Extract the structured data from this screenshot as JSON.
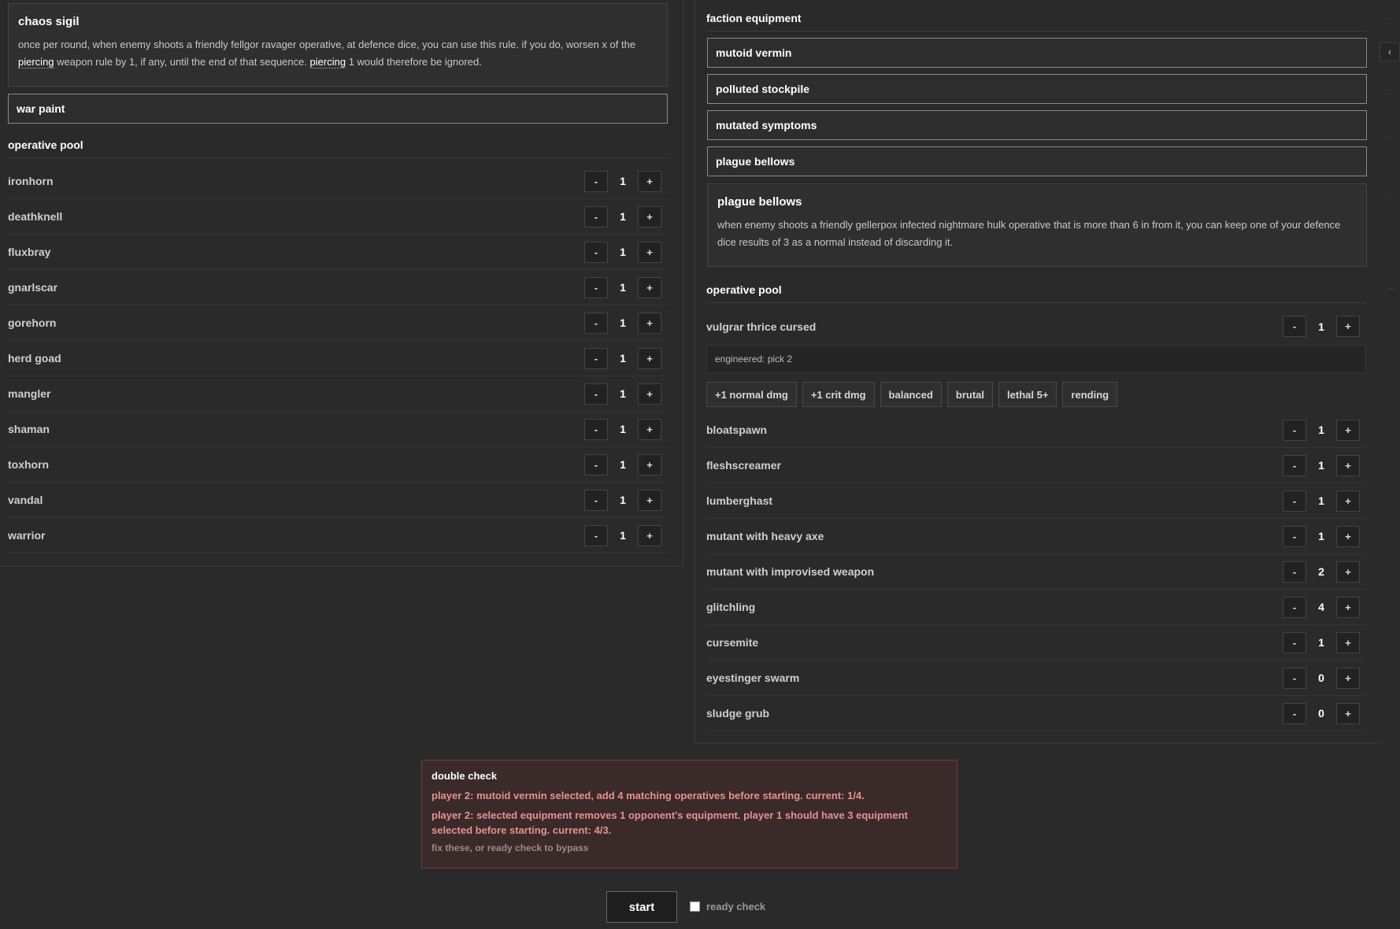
{
  "left": {
    "chaos_sigil": {
      "title": "chaos sigil",
      "text_1": "once per round, when enemy shoots a friendly fellgor ravager operative, at defence dice, you can use this rule. if you do, worsen x of the",
      "kw_1": "piercing",
      "text_2": "weapon rule by 1, if any, until the end of that sequence.",
      "kw_2": "piercing",
      "text_3": "1 would therefore be ignored."
    },
    "war_paint": "war paint",
    "pool_title": "operative pool",
    "operatives": [
      {
        "name": "ironhorn",
        "count": "1"
      },
      {
        "name": "deathknell",
        "count": "1"
      },
      {
        "name": "fluxbray",
        "count": "1"
      },
      {
        "name": "gnarlscar",
        "count": "1"
      },
      {
        "name": "gorehorn",
        "count": "1"
      },
      {
        "name": "herd goad",
        "count": "1"
      },
      {
        "name": "mangler",
        "count": "1"
      },
      {
        "name": "shaman",
        "count": "1"
      },
      {
        "name": "toxhorn",
        "count": "1"
      },
      {
        "name": "vandal",
        "count": "1"
      },
      {
        "name": "warrior",
        "count": "1"
      }
    ]
  },
  "right": {
    "equip_title": "faction equipment",
    "equipment": [
      "mutoid vermin",
      "polluted stockpile",
      "mutated symptoms",
      "plague bellows"
    ],
    "bellows_rule": {
      "title": "plague bellows",
      "text": "when enemy shoots a friendly gellerpox infected nightmare hulk operative that is more than 6 in from it, you can keep one of your defence dice results of 3 as a normal instead of discarding it."
    },
    "pool_title": "operative pool",
    "first_op": {
      "name": "vulgrar thrice cursed",
      "count": "1"
    },
    "engineered": "engineered: pick 2",
    "rule_chips": [
      "+1 normal dmg",
      "+1 crit dmg",
      "balanced",
      "brutal",
      "lethal 5+",
      "rending"
    ],
    "operatives": [
      {
        "name": "bloatspawn",
        "count": "1"
      },
      {
        "name": "fleshscreamer",
        "count": "1"
      },
      {
        "name": "lumberghast",
        "count": "1"
      },
      {
        "name": "mutant with heavy axe",
        "count": "1"
      },
      {
        "name": "mutant with improvised weapon",
        "count": "2"
      },
      {
        "name": "glitchling",
        "count": "4"
      },
      {
        "name": "cursemite",
        "count": "1"
      },
      {
        "name": "eyestinger swarm",
        "count": "0"
      },
      {
        "name": "sludge grub",
        "count": "0"
      }
    ]
  },
  "stepper": {
    "minus": "-",
    "plus": "+"
  },
  "double_check": {
    "title": "double check",
    "messages": [
      "player 2: mutoid vermin selected, add 4 matching operatives before starting. current: 1/4.",
      "player 2: selected equipment removes 1 opponent's equipment. player 1 should have 3 equipment selected before starting. current: 4/3."
    ],
    "footer": "fix these, or ready check to bypass"
  },
  "start_label": "start",
  "ready_label": "ready check",
  "side_tab": "‹",
  "colors": {
    "background": "#2a2a2a",
    "warning": "#e89090",
    "warning_border": "#7a3a3a"
  }
}
